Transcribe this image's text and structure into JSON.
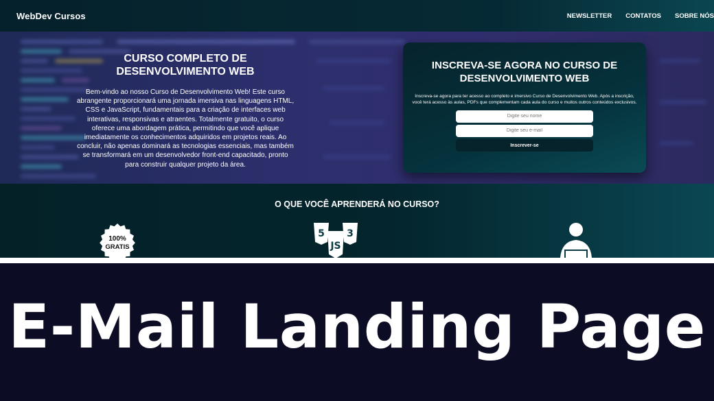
{
  "navbar": {
    "brand": "WebDev Cursos",
    "links": [
      "NEWSLETTER",
      "CONTATOS",
      "SOBRE NÓS"
    ]
  },
  "hero": {
    "title": "CURSO COMPLETO DE DESENVOLVIMENTO WEB",
    "text": "Bem-vindo ao nosso Curso de Desenvolvimento Web! Este curso abrangente proporcionará uma jornada imersiva nas linguagens HTML, CSS e JavaScript, fundamentais para a criação de interfaces web interativas, responsivas e atraentes. Totalmente gratuito, o curso oferece uma abordagem prática, permitindo que você aplique imediatamente os conhecimentos adquiridos em projetos reais. Ao concluir, não apenas dominará as tecnologias essenciais, mas também se transformará em um desenvolvedor front-end capacitado, pronto para construir qualquer projeto da área."
  },
  "signup": {
    "title": "INSCREVA-SE AGORA NO CURSO DE DESENVOLVIMENTO WEB",
    "text": "Inscreva-se agora para ter acesso ao completo e imersivo Curso de Desenvolvimento Web. Após a inscrição, você terá acesso às aulas, PDFs que complementam cada aula do curso e muitos outros conteúdos exclusivos.",
    "name_placeholder": "Digite seu nome",
    "email_placeholder": "Digite seu e-mail",
    "submit_label": "Inscrever-se"
  },
  "learn": {
    "title": "O QUE VOCÊ APRENDERÁ NO CURSO?",
    "badge_line1": "100%",
    "badge_line2": "GRATIS",
    "icons": [
      "free-badge-icon",
      "html-css-js-icon",
      "developer-laptop-icon"
    ]
  },
  "banner": {
    "title": "E-Mail Landing Page"
  },
  "colors": {
    "background": "#0c0c24",
    "navbar": "#05212b",
    "hero": "#2d2f6d",
    "card": "#05323c",
    "accent_teal": "#0a4b55",
    "text": "#ffffff"
  }
}
